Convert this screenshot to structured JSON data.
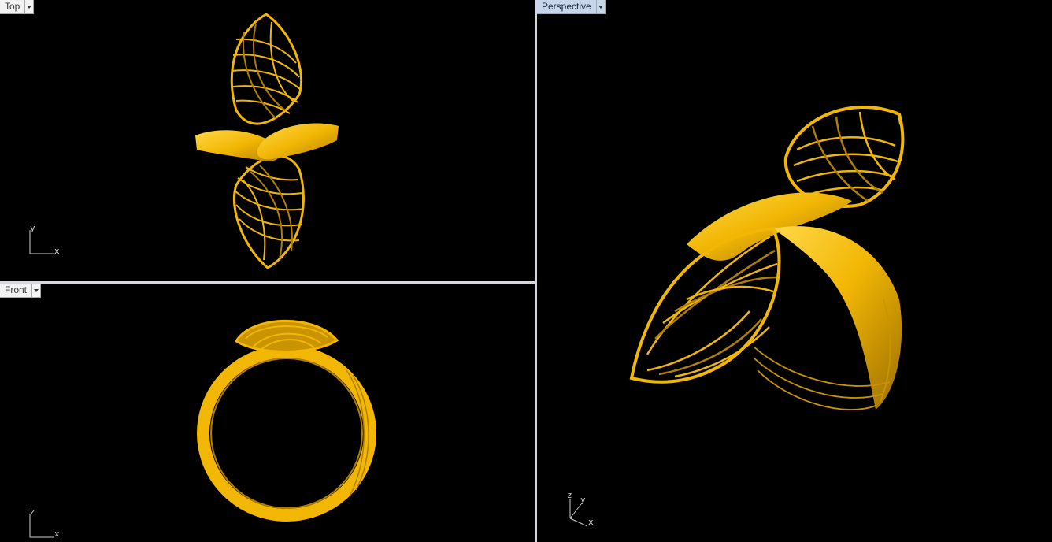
{
  "viewports": {
    "top": {
      "label": "Top",
      "axis_v": "y",
      "axis_h": "x"
    },
    "front": {
      "label": "Front",
      "axis_v": "z",
      "axis_h": "x"
    },
    "perspective": {
      "label": "Perspective",
      "axis_z": "z",
      "axis_y": "y",
      "axis_x": "x"
    }
  },
  "colors": {
    "gold": "#f2b705",
    "gold_dark": "#a97a00",
    "background": "#000000",
    "active_tab": "#c8d6ea"
  },
  "icons": {
    "dropdown": "chevron-down-icon"
  }
}
